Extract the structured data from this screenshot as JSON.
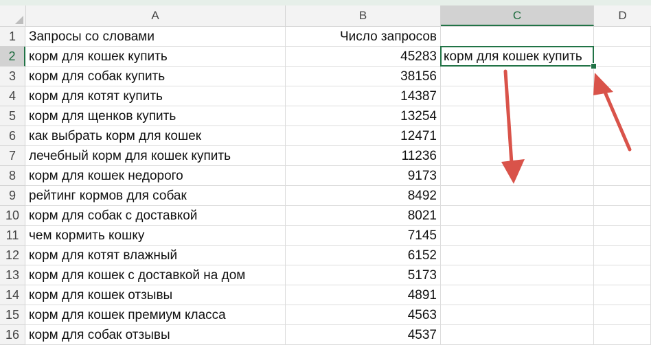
{
  "columns": [
    "A",
    "B",
    "C",
    "D"
  ],
  "selected_column": "C",
  "selected_row": "2",
  "rows": [
    {
      "num": "1",
      "a": "Запросы со словами",
      "b": "Число запросов",
      "c": ""
    },
    {
      "num": "2",
      "a": "корм для кошек купить",
      "b": "45283",
      "c": "корм для кошек купить"
    },
    {
      "num": "3",
      "a": "корм для собак купить",
      "b": "38156",
      "c": ""
    },
    {
      "num": "4",
      "a": "корм для котят купить",
      "b": "14387",
      "c": ""
    },
    {
      "num": "5",
      "a": "корм для щенков купить",
      "b": "13254",
      "c": ""
    },
    {
      "num": "6",
      "a": "как выбрать корм для кошек",
      "b": "12471",
      "c": ""
    },
    {
      "num": "7",
      "a": "лечебный корм для кошек купить",
      "b": "11236",
      "c": ""
    },
    {
      "num": "8",
      "a": "корм для кошек недорого",
      "b": "9173",
      "c": ""
    },
    {
      "num": "9",
      "a": "рейтинг кормов для собак",
      "b": "8492",
      "c": ""
    },
    {
      "num": "10",
      "a": "корм для собак с доставкой",
      "b": "8021",
      "c": ""
    },
    {
      "num": "11",
      "a": "чем кормить кошку",
      "b": "7145",
      "c": ""
    },
    {
      "num": "12",
      "a": "корм для котят влажный",
      "b": "6152",
      "c": ""
    },
    {
      "num": "13",
      "a": "корм для кошек с доставкой на дом",
      "b": "5173",
      "c": ""
    },
    {
      "num": "14",
      "a": "корм для кошек отзывы",
      "b": "4891",
      "c": ""
    },
    {
      "num": "15",
      "a": "корм для кошек премиум класса",
      "b": "4563",
      "c": ""
    },
    {
      "num": "16",
      "a": "корм для собак отзывы",
      "b": "4537",
      "c": ""
    }
  ],
  "colors": {
    "accent": "#217346",
    "arrow": "#d9534a",
    "header_bg": "#f3f3f3",
    "gridline": "#dcdcdc"
  }
}
